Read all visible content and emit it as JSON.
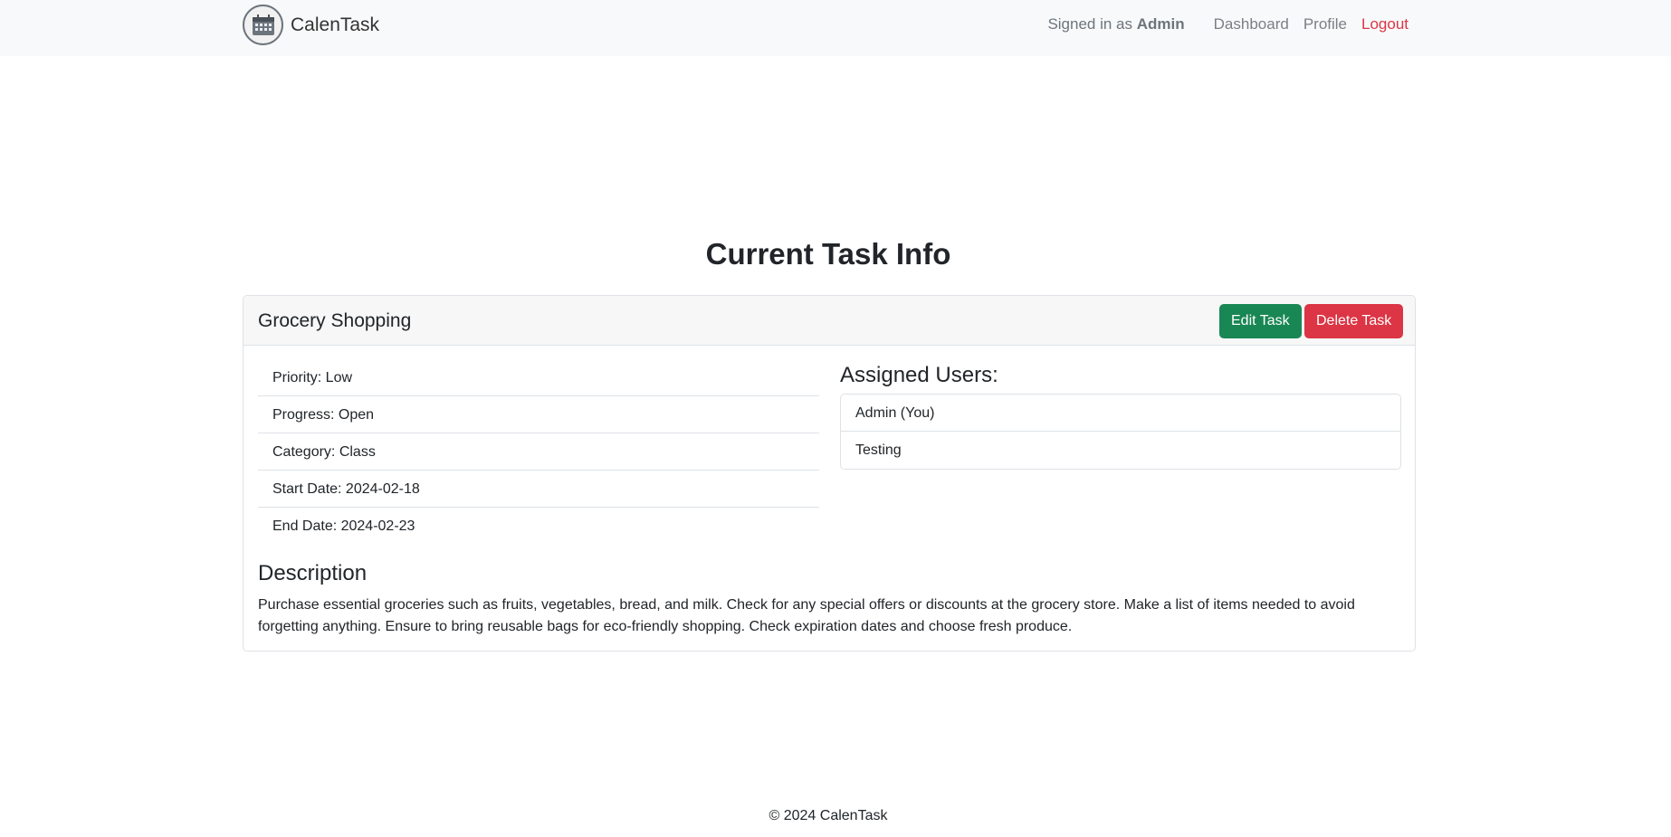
{
  "nav": {
    "brand": "CalenTask",
    "signed_in_prefix": "Signed in as",
    "user": "Admin",
    "links": {
      "dashboard": "Dashboard",
      "profile": "Profile",
      "logout": "Logout"
    }
  },
  "page": {
    "title": "Current Task Info"
  },
  "task": {
    "name": "Grocery Shopping",
    "edit_label": "Edit Task",
    "delete_label": "Delete Task",
    "details": [
      "Priority: Low",
      "Progress: Open",
      "Category: Class",
      "Start Date: 2024-02-18",
      "End Date: 2024-02-23"
    ],
    "assigned_title": "Assigned Users:",
    "assigned_users": [
      "Admin (You)",
      "Testing"
    ],
    "description_title": "Description",
    "description": "Purchase essential groceries such as fruits, vegetables, bread, and milk. Check for any special offers or discounts at the grocery store. Make a list of items needed to avoid forgetting anything. Ensure to bring reusable bags for eco-friendly shopping. Check expiration dates and choose fresh produce."
  },
  "footer": {
    "text": "© 2024 CalenTask"
  },
  "colors": {
    "edit_button": "#198754",
    "delete_button": "#dc3545",
    "logout_link": "#dc3545",
    "navbar_bg": "#f8f9fa"
  },
  "icons": {
    "brand_logo": "calendar-icon"
  }
}
